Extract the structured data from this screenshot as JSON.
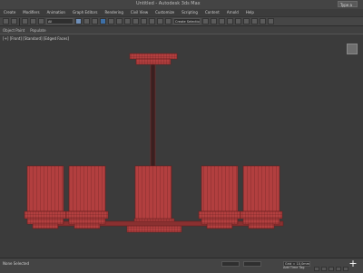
{
  "app": {
    "title": "Untitled - Autodesk 3ds Max",
    "search_placeholder": "Type a keyword or phrase"
  },
  "menubar": {
    "items": [
      "Create",
      "Modifiers",
      "Animation",
      "Graph Editors",
      "Rendering",
      "Civil View",
      "Customize",
      "Scripting",
      "Content",
      "Arnold",
      "Help"
    ]
  },
  "toolbar": {
    "selection_filter": "All",
    "named_selection": "Create Selection Set"
  },
  "ribbon": {
    "items": [
      "Object Paint",
      "Populate"
    ]
  },
  "viewport": {
    "label": "[+] [Front] [Standard] [Edged Faces]",
    "background": "#3b3b3b",
    "wire_color": "#c84a4a",
    "object_fill": "#b23f3f"
  },
  "statusbar": {
    "status_text": "None Selected",
    "prompt_text": "Click or click-and-drag to select objects",
    "x_value": "",
    "y_value": "",
    "grid_value": "Grid = 10,0mm",
    "add_time_tag": "Add Time Tag",
    "auto_key": "Auto Key",
    "set_key": "Set Key"
  },
  "colors": {
    "accent": "#3d6fa6",
    "chrome": "#444444"
  }
}
